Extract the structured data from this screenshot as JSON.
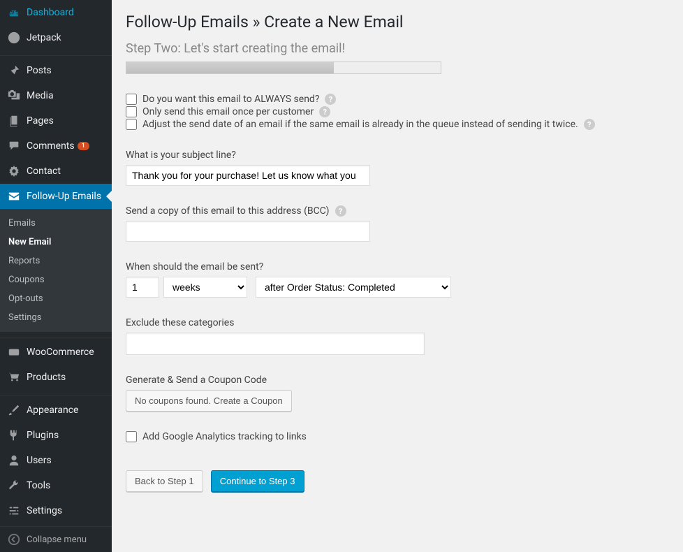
{
  "sidebar": {
    "items": [
      {
        "label": "Dashboard"
      },
      {
        "label": "Jetpack"
      },
      {
        "label": "Posts"
      },
      {
        "label": "Media"
      },
      {
        "label": "Pages"
      },
      {
        "label": "Comments",
        "badge": "1"
      },
      {
        "label": "Contact"
      },
      {
        "label": "Follow-Up Emails"
      },
      {
        "label": "WooCommerce"
      },
      {
        "label": "Products"
      },
      {
        "label": "Appearance"
      },
      {
        "label": "Plugins"
      },
      {
        "label": "Users"
      },
      {
        "label": "Tools"
      },
      {
        "label": "Settings"
      }
    ],
    "submenu": [
      {
        "label": "Emails"
      },
      {
        "label": "New Email"
      },
      {
        "label": "Reports"
      },
      {
        "label": "Coupons"
      },
      {
        "label": "Opt-outs"
      },
      {
        "label": "Settings"
      }
    ],
    "collapse": "Collapse menu"
  },
  "page": {
    "title": "Follow-Up Emails » Create a New Email",
    "step_title": "Step Two: Let's start creating the email!"
  },
  "checkboxes": {
    "always_send": "Do you want this email to ALWAYS send?",
    "once_per_customer": "Only send this email once per customer",
    "adjust_date": "Adjust the send date of an email if the same email is already in the queue instead of sending it twice."
  },
  "fields": {
    "subject_label": "What is your subject line?",
    "subject_value": "Thank you for your purchase! Let us know what you",
    "bcc_label": "Send a copy of this email to this address (BCC)",
    "bcc_value": "",
    "timing_label": "When should the email be sent?",
    "timing_num": "1",
    "timing_unit": "weeks",
    "timing_event": "after Order Status: Completed",
    "exclude_label": "Exclude these categories",
    "coupon_label": "Generate & Send a Coupon Code",
    "coupon_button": "No coupons found. Create a Coupon",
    "ga_label": "Add Google Analytics tracking to links"
  },
  "actions": {
    "back": "Back to Step 1",
    "continue": "Continue to Step 3"
  }
}
